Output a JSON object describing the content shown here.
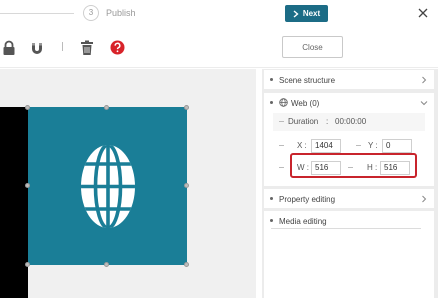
{
  "topbar": {
    "step_number": "3",
    "step_label": "Publish",
    "next_label": "Next"
  },
  "toolbar": {
    "icons": [
      "lock-icon",
      "magnet-icon",
      "trash-icon",
      "help-icon"
    ],
    "close_label": "Close"
  },
  "panel": {
    "scene_structure": "Scene structure",
    "web_title": "Web (0)",
    "duration_label": "Duration",
    "duration_sep": ":",
    "duration_value": "00:00:00",
    "x_label": "X :",
    "x_value": "1404",
    "y_label": "Y :",
    "y_value": "0",
    "w_label": "W :",
    "w_value": "516",
    "h_label": "H :",
    "h_value": "516",
    "property_editing": "Property editing",
    "media_editing": "Media editing"
  },
  "colors": {
    "accent": "#1c6c86",
    "media_bg": "#1a7e97",
    "help_red": "#d8232a",
    "highlight_red": "#c8242c"
  }
}
